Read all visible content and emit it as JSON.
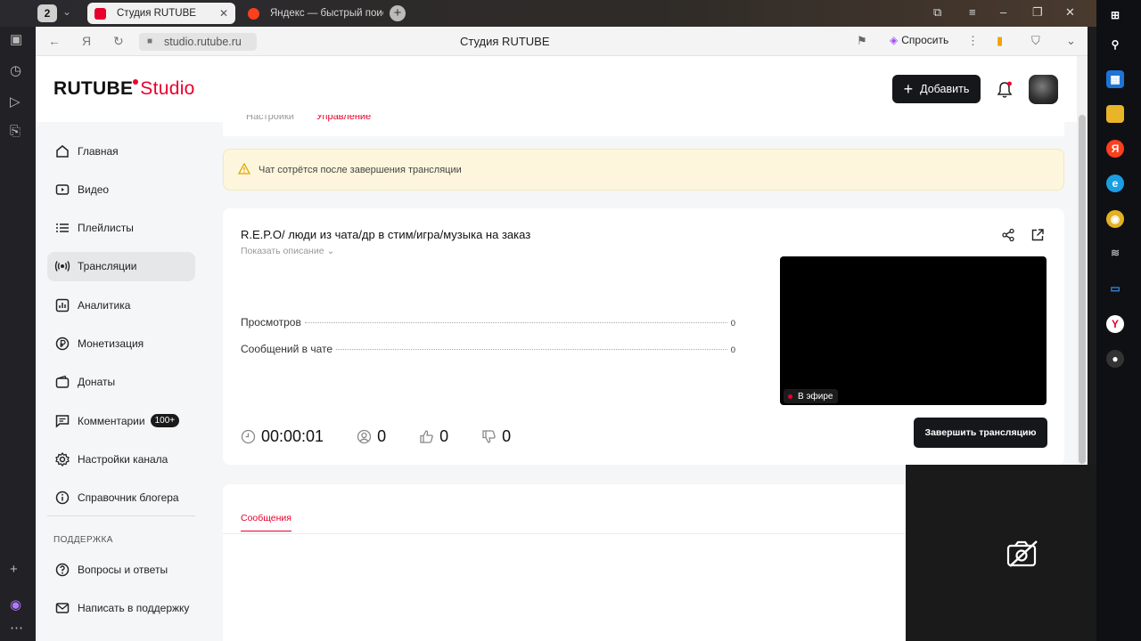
{
  "browser": {
    "tab_count": "2",
    "tabs": [
      {
        "title": "Студия RUTUBE",
        "active": true
      },
      {
        "title": "Яндекс — быстрый поиск",
        "active": false
      }
    ],
    "url": "studio.rutube.ru",
    "page_title": "Студия RUTUBE",
    "ask_label": "Спросить"
  },
  "header": {
    "logo_main": "RUTUBE",
    "logo_suffix": "Studio",
    "add_button": "Добавить"
  },
  "sidebar": {
    "items": [
      {
        "label": "Главная",
        "icon": "home-icon"
      },
      {
        "label": "Видео",
        "icon": "video-icon"
      },
      {
        "label": "Плейлисты",
        "icon": "playlist-icon"
      },
      {
        "label": "Трансляции",
        "icon": "broadcast-icon",
        "active": true
      },
      {
        "label": "Аналитика",
        "icon": "analytics-icon"
      },
      {
        "label": "Монетизация",
        "icon": "monetization-icon"
      },
      {
        "label": "Донаты",
        "icon": "wallet-icon"
      },
      {
        "label": "Комментарии",
        "icon": "comments-icon",
        "badge": "100+"
      },
      {
        "label": "Настройки канала",
        "icon": "gear-icon"
      },
      {
        "label": "Справочник блогера",
        "icon": "info-icon"
      }
    ],
    "support_title": "ПОДДЕРЖКА",
    "support_items": [
      {
        "label": "Вопросы и ответы",
        "icon": "question-icon"
      },
      {
        "label": "Написать в поддержку",
        "icon": "mail-icon"
      }
    ]
  },
  "page_tabs": [
    "Настройки",
    "Управление"
  ],
  "warning": "Чат сотрётся после завершения трансляции",
  "stream": {
    "title": "R.E.P.O/ люди из чата/др в стим/игра/музыка на заказ",
    "show_description": "Показать описание",
    "stats": [
      {
        "label": "Просмотров",
        "value": "0"
      },
      {
        "label": "Сообщений в чате",
        "value": "0"
      }
    ],
    "live_label": "В эфире",
    "duration": "00:00:01",
    "viewers": "0",
    "likes": "0",
    "dislikes": "0",
    "end_button": "Завершить трансляцию"
  },
  "chat": {
    "tab_label": "Сообщения"
  },
  "colors": {
    "accent": "#e8002d",
    "dark_button": "#15171a",
    "warning_bg": "#fdf6dc"
  }
}
